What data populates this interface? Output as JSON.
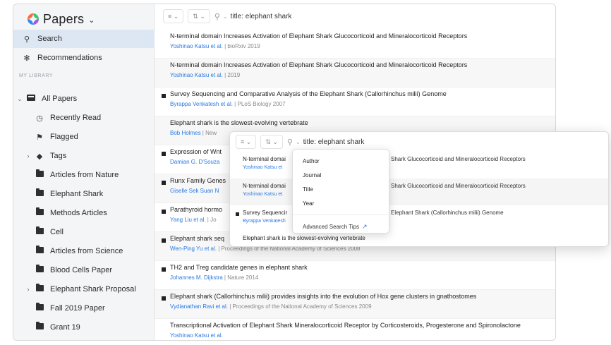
{
  "app": {
    "title": "Papers",
    "caret": "⌄"
  },
  "sidebar": {
    "nav": [
      {
        "label": "Search",
        "icon": "search-icon"
      },
      {
        "label": "Recommendations",
        "icon": "sparkle-icon"
      }
    ],
    "section_label": "MY LIBRARY",
    "all_papers": "All Papers",
    "items": [
      "Recently Read",
      "Flagged",
      "Tags",
      "Articles from Nature",
      "Elephant Shark",
      "Methods Articles",
      "Cell",
      "Articles from Science",
      "Blood Cells Paper",
      "Elephant Shark Proposal",
      "Fall 2019 Paper",
      "Grant 19"
    ]
  },
  "toolbar": {
    "list_btn": "≡ ⌄",
    "sort_btn": "⇅ ⌄",
    "search_scope": "⌄",
    "search_value": "title: elephant shark"
  },
  "results": [
    {
      "title": "N-terminal domain Increases Activation of Elephant Shark Glucocorticoid and Mineralocorticoid Receptors",
      "author": "Yoshinao Katsu et al.",
      "source": " | bioRxiv 2019",
      "marked": false
    },
    {
      "title": "N-terminal domain Increases Activation of Elephant Shark Glucocorticoid and Mineralocorticoid Receptors",
      "author": "Yoshinao Katsu et al.",
      "source": " | 2019",
      "marked": false
    },
    {
      "title": "Survey Sequencing and Comparative Analysis of the Elephant Shark (Callorhinchus milii) Genome",
      "author": "Byrappa Venkatesh et al.",
      "source": " | PLoS Biology 2007",
      "marked": true
    },
    {
      "title": "Elephant shark is the slowest-evolving vertebrate",
      "author": "Bob Holmes",
      "source": " | New",
      "marked": false
    },
    {
      "title": "Expression of Wnt",
      "author": "Damian G. D'Souza",
      "source": "",
      "marked": true
    },
    {
      "title": "Runx Family Genes",
      "author": "Giselle Sek Suan N",
      "source": "",
      "marked": true
    },
    {
      "title": "Parathyroid hormo",
      "author": "Yang Liu et al.",
      "source": " | Jo",
      "marked": true
    },
    {
      "title": "Elephant shark seq",
      "author": "Wen-Ping Yu et al.",
      "source": " | Proceedings of the National Academy of Sciences 2008",
      "marked": true
    },
    {
      "title": "TH2 and Treg candidate genes in elephant shark",
      "author": "Johannes M. Dijkstra",
      "source": " | Nature 2014",
      "marked": true
    },
    {
      "title": "Elephant shark (Callorhinchus milii) provides insights into the evolution of Hox gene clusters in gnathostomes",
      "author": "Vydianathan Ravi et al.",
      "source": " | Proceedings of the National Academy of Sciences 2009",
      "marked": true
    },
    {
      "title": "Transcriptional Activation of Elephant Shark Mineralocorticoid Receptor by Corticosteroids, Progesterone and Spironolactone",
      "author": "Yoshinao Katsu et al.",
      "source": "",
      "marked": false
    }
  ],
  "overlay": {
    "list_btn": "≡ ⌄",
    "sort_btn": "⇅ ⌄",
    "search_scope": "⌄",
    "search_value": "title: elephant shark",
    "rows": [
      {
        "left": "N-terminal domai",
        "author": "Yoshinao Katsu et",
        "right": "Shark Glucocorticoid and Mineralocorticoid Receptors",
        "marked": false
      },
      {
        "left": "N-terminal domai",
        "author": "Yoshinao Katsu et",
        "right": "Shark Glucocorticoid and Mineralocorticoid Receptors",
        "marked": false
      },
      {
        "left": "Survey Sequencir",
        "author": "Byrappa Venkatesh",
        "right": "Elephant Shark (Callorhinchus milii) Genome",
        "marked": true
      }
    ],
    "bottom_text": "Elephant shark is the slowest-evolving vertebrate",
    "dropdown": {
      "options": [
        "Author",
        "Journal",
        "Title",
        "Year"
      ],
      "tips": "Advanced Search Tips",
      "tips_icon": "↗"
    }
  }
}
